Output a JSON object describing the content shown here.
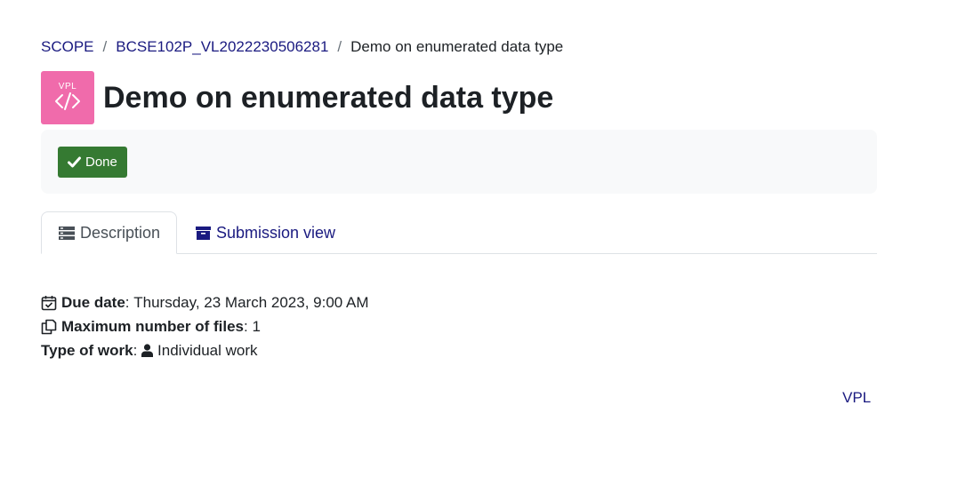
{
  "breadcrumb": {
    "items": [
      "SCOPE",
      "BCSE102P_VL2022230506281"
    ],
    "separator": "/",
    "current": "Demo on enumerated data type"
  },
  "header": {
    "icon_text": "VPL",
    "icon_name": "code-icon",
    "icon_color": "#f06bab",
    "title": "Demo on enumerated data type"
  },
  "completion": {
    "done_label": "Done",
    "done_icon": "check-icon",
    "done_color": "#357a32"
  },
  "tabs": [
    {
      "label": "Description",
      "icon": "list-icon",
      "active": true
    },
    {
      "label": "Submission view",
      "icon": "archive-icon",
      "active": false
    }
  ],
  "details": {
    "due_date_label": "Due date",
    "due_date_value": "Thursday, 23 March 2023, 9:00 AM",
    "max_files_label": "Maximum number of files",
    "max_files_value": "1",
    "work_type_label": "Type of work",
    "work_type_value": "Individual work"
  },
  "footer": {
    "link_label": "VPL"
  },
  "colors": {
    "link": "#1a1a80",
    "text": "#1d2125"
  }
}
